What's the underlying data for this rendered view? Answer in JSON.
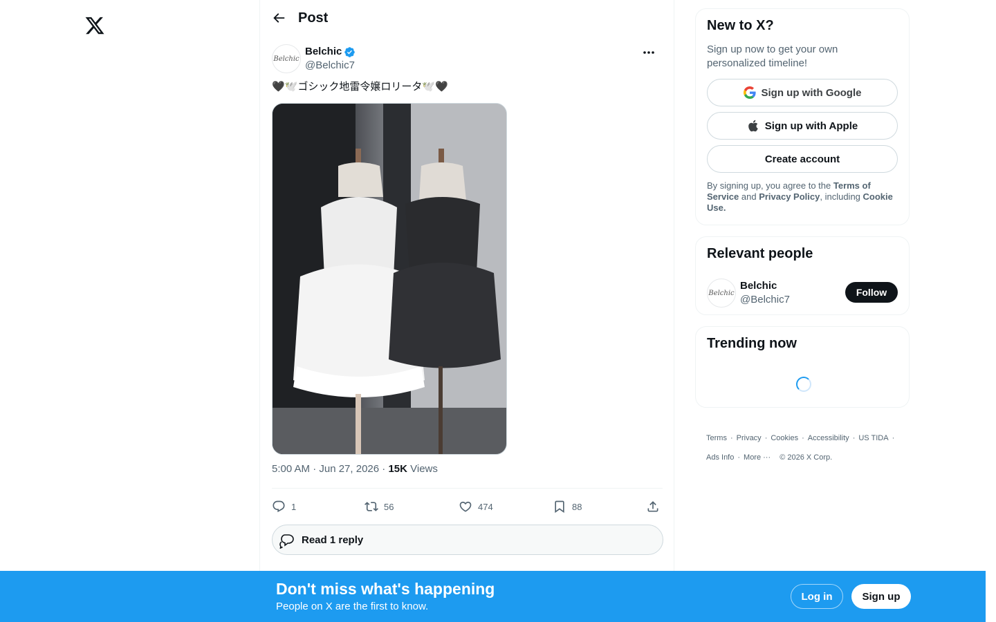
{
  "header": {
    "title": "Post"
  },
  "post": {
    "author_name": "Belchic",
    "author_handle": "@Belchic7",
    "avatar_text": "Belchic",
    "text": "🖤🕊️ゴシック地雷令嬢ロリータ🕊️🖤",
    "time": "5:00 AM · Jun 27, 2026 · ",
    "views_count": "15K",
    "views_label": " Views",
    "replies": "1",
    "reposts": "56",
    "likes": "474",
    "bookmarks": "88",
    "read_reply_label": "Read 1 reply"
  },
  "signup_card": {
    "title": "New to X?",
    "description": "Sign up now to get your own personalized timeline!",
    "google_label": "Sign up with Google",
    "apple_label": "Sign up with Apple",
    "create_label": "Create account",
    "legal_prefix": "By signing up, you agree to the ",
    "terms_link": "Terms of Service",
    "legal_and": " and ",
    "privacy_link": "Privacy Policy",
    "legal_including": ", including ",
    "cookie_link": "Cookie Use."
  },
  "relevant_people": {
    "title": "Relevant people",
    "name": "Belchic",
    "handle": "@Belchic7",
    "follow_label": "Follow"
  },
  "trending": {
    "title": "Trending now"
  },
  "footer": {
    "terms": "Terms",
    "privacy": "Privacy",
    "cookies": "Cookies",
    "accessibility": "Accessibility",
    "us_tida": "US TIDA",
    "ads_info": "Ads Info",
    "more": "More ···",
    "copyright": "© 2026 X Corp."
  },
  "banner": {
    "title": "Don't miss what's happening",
    "subtitle": "People on X are the first to know.",
    "login_label": "Log in",
    "signup_label": "Sign up"
  },
  "colors": {
    "accent": "#1d9bf0",
    "text": "#0f1419",
    "muted": "#536471",
    "border": "#eff3f4"
  },
  "icons": [
    "x-logo-icon",
    "back-arrow-icon",
    "verified-badge-icon",
    "more-icon",
    "reply-icon",
    "repost-icon",
    "like-icon",
    "bookmark-icon",
    "share-icon",
    "read-reply-icon",
    "google-icon",
    "apple-icon",
    "loading-spinner"
  ]
}
